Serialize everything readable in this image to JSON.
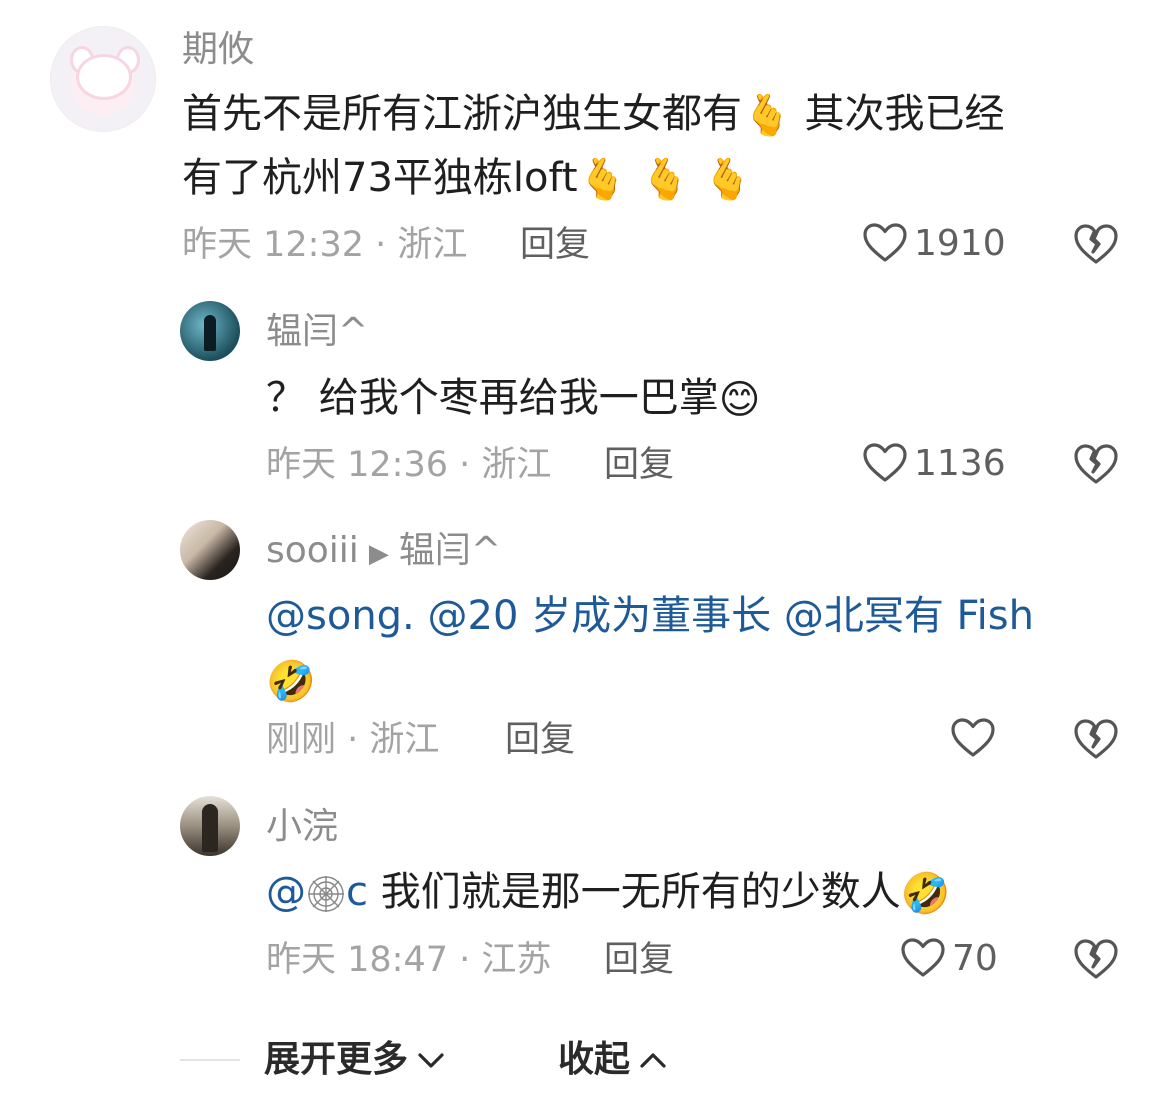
{
  "comments": [
    {
      "name": "期攸",
      "text_a": "首先不是所有江浙沪独生女都有",
      "text_b": "其次我已经",
      "text_c": "有了杭州73平独栋loft",
      "emoji_heart_hand": "🫰",
      "time_loc": "昨天 12:32 · 浙江",
      "reply": "回复",
      "likes": "1910"
    },
    {
      "name": "辒闫^",
      "text": "？ 给我个枣再给我一巴掌",
      "emoji": "😊",
      "time_loc": "昨天 12:36 · 浙江",
      "reply": "回复",
      "likes": "1136"
    },
    {
      "name": "sooiii",
      "reply_to": "辒闫^",
      "mentions": [
        "@song.",
        "@20 岁成为董事长",
        "@北冥有 Fish"
      ],
      "emoji": "🤣",
      "time_loc": "刚刚 · 浙江",
      "reply": "回复",
      "likes": ""
    },
    {
      "name": "小浣",
      "mention": "@",
      "mention_icon": "cobweb-icon",
      "mention_c": "c",
      "text": "我们就是那一无所有的少数人",
      "emoji": "🤣",
      "time_loc": "昨天 18:47 · 江苏",
      "reply": "回复",
      "likes": "70"
    }
  ],
  "footer": {
    "expand_more": "展开更多",
    "collapse": "收起"
  }
}
